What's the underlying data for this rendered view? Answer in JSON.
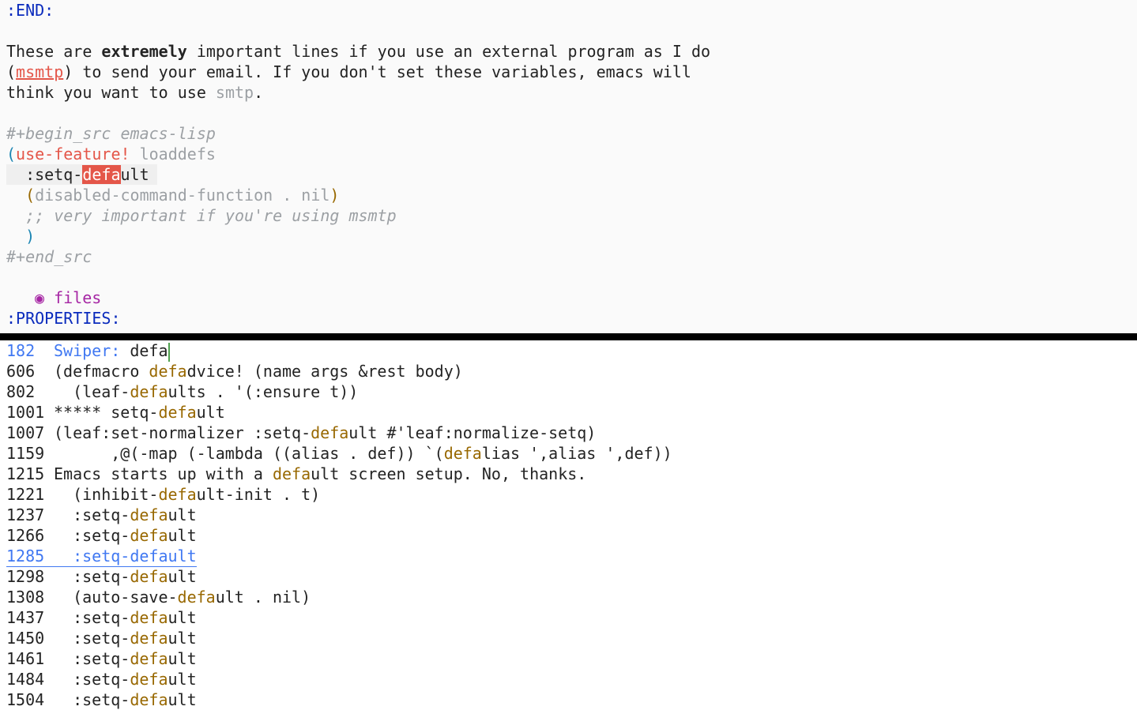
{
  "editor": {
    "end_drawer": ":END:",
    "para": {
      "l1a": "These are ",
      "l1b": "extremely",
      "l1c": " important lines if you use an external program as I do",
      "l2a": "(",
      "l2b": "msmtp",
      "l2c": ") to send your email. If you don't set these variables, emacs will",
      "l3a": "think you want to use ",
      "l3b": "smtp",
      "l3c": "."
    },
    "src_begin": "#+begin_src emacs-lisp",
    "code": {
      "c1_open": "(",
      "c1_fn": "use-feature!",
      "c1_arg": " loaddefs",
      "c2_pre": "  :setq-",
      "c2_match": "defa",
      "c2_post": "ult ",
      "c3_open": "  (",
      "c3_body": "disabled-command-function . nil",
      "c3_close": ")",
      "c4_comment": "  ;; very important if you're using msmtp",
      "c5_close": "  )"
    },
    "src_end": "#+end_src",
    "heading_bullet": "◉",
    "heading_text": "files",
    "properties": ":PROPERTIES:"
  },
  "minibuffer": {
    "prompt_count": "182",
    "prompt_label": "Swiper: ",
    "query": "defa",
    "rows": [
      {
        "num": "606",
        "pre": "(defmacro ",
        "match": "defa",
        "post": "dvice! (name args &rest body)"
      },
      {
        "num": "802",
        "pre": "  (leaf-",
        "match": "defa",
        "post": "ults . '(:ensure t))"
      },
      {
        "num": "1001",
        "pre": "***** setq-",
        "match": "defa",
        "post": "ult"
      },
      {
        "num": "1007",
        "pre": "(leaf:set-normalizer :setq-",
        "match": "defa",
        "post": "ult #'leaf:normalize-setq)"
      },
      {
        "num": "1159",
        "pre": "      ,@(-map (-lambda ((alias . def)) `(",
        "match": "defa",
        "post": "lias ',alias ',def))"
      },
      {
        "num": "1215",
        "pre": "Emacs starts up with a ",
        "match": "defa",
        "post": "ult screen setup. No, thanks."
      },
      {
        "num": "1221",
        "pre": "  (inhibit-",
        "match": "defa",
        "post": "ult-init . t)"
      },
      {
        "num": "1237",
        "pre": "  :setq-",
        "match": "defa",
        "post": "ult"
      },
      {
        "num": "1266",
        "pre": "  :setq-",
        "match": "defa",
        "post": "ult"
      },
      {
        "num": "1285",
        "pre": "  :setq-",
        "match": "defa",
        "post": "ult"
      },
      {
        "num": "1298",
        "pre": "  :setq-",
        "match": "defa",
        "post": "ult"
      },
      {
        "num": "1308",
        "pre": "  (auto-save-",
        "match": "defa",
        "post": "ult . nil)"
      },
      {
        "num": "1437",
        "pre": "  :setq-",
        "match": "defa",
        "post": "ult"
      },
      {
        "num": "1450",
        "pre": "  :setq-",
        "match": "defa",
        "post": "ult"
      },
      {
        "num": "1461",
        "pre": "  :setq-",
        "match": "defa",
        "post": "ult"
      },
      {
        "num": "1484",
        "pre": "  :setq-",
        "match": "defa",
        "post": "ult"
      },
      {
        "num": "1504",
        "pre": "  :setq-",
        "match": "defa",
        "post": "ult"
      }
    ]
  },
  "colors": {
    "background": "#fafafa",
    "keyword_blue": "#0a2bbd",
    "match_gold": "#986801",
    "prompt_blue": "#4078f2",
    "accent_red": "#e45649",
    "heading_purple": "#a626a4"
  }
}
